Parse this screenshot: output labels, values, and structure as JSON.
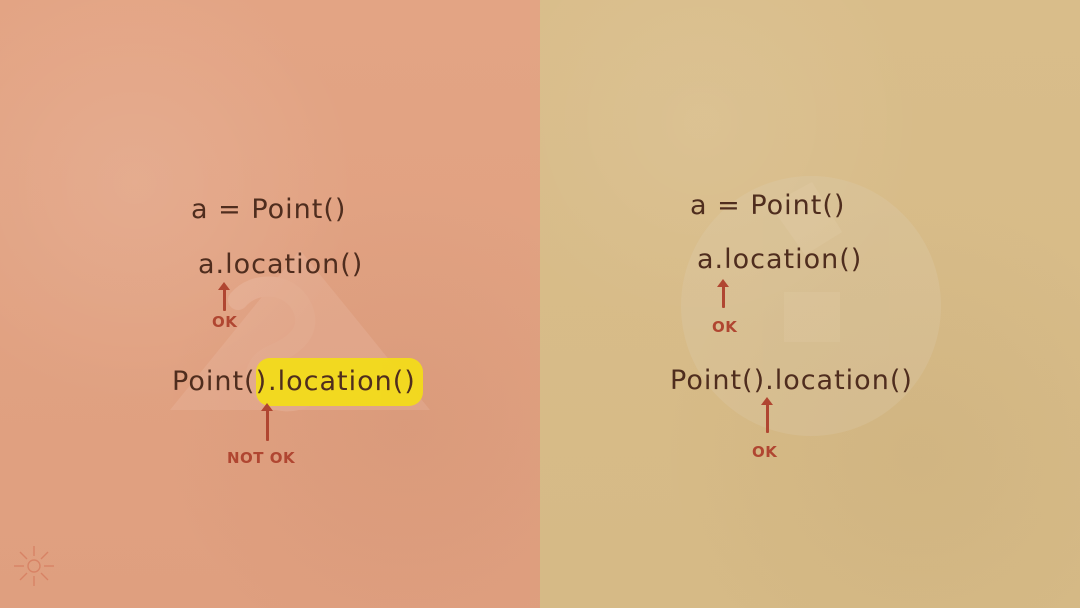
{
  "colors": {
    "left_bg": "#e3a484",
    "right_bg": "#d9bd8a",
    "ink": "#4f2d1e",
    "note_red": "#b04631",
    "highlight": "#f2db1a",
    "watermark": "#f3cfc0"
  },
  "icons": {
    "left_watermark": "python-triangle-logo",
    "right_watermark": "circle-logo",
    "corner": "sun-doodle-icon"
  },
  "left": {
    "line1": "a = Point()",
    "line2": "a.location()",
    "note1": "OK",
    "line3_prefix": "Point()",
    "line3_highlight": ".location()",
    "note2": "NOT OK"
  },
  "right": {
    "line1": "a = Point()",
    "line2": "a.location()",
    "note1": "OK",
    "line3": "Point().location()",
    "note2": "OK"
  }
}
